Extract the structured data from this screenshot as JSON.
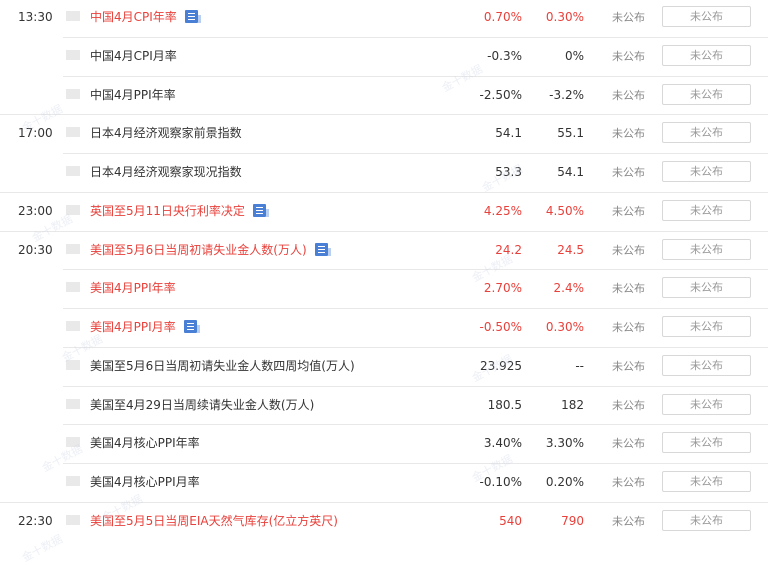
{
  "rows": [
    {
      "time": "13:30",
      "name": "中国4月CPI年率",
      "actual": "0.70%",
      "forecast": "0.30%",
      "status": "未公布",
      "button": "未公布",
      "red": true,
      "icon": true,
      "group_start": true
    },
    {
      "time": "",
      "name": "中国4月CPI月率",
      "actual": "-0.3%",
      "forecast": "0%",
      "status": "未公布",
      "button": "未公布",
      "red": false,
      "icon": false,
      "group_start": false
    },
    {
      "time": "",
      "name": "中国4月PPI年率",
      "actual": "-2.50%",
      "forecast": "-3.2%",
      "status": "未公布",
      "button": "未公布",
      "red": false,
      "icon": false,
      "group_start": false
    },
    {
      "time": "17:00",
      "name": "日本4月经济观察家前景指数",
      "actual": "54.1",
      "forecast": "55.1",
      "status": "未公布",
      "button": "未公布",
      "red": false,
      "icon": false,
      "group_start": true
    },
    {
      "time": "",
      "name": "日本4月经济观察家现况指数",
      "actual": "53.3",
      "forecast": "54.1",
      "status": "未公布",
      "button": "未公布",
      "red": false,
      "icon": false,
      "group_start": false
    },
    {
      "time": "23:00",
      "name": "英国至5月11日央行利率决定",
      "actual": "4.25%",
      "forecast": "4.50%",
      "status": "未公布",
      "button": "未公布",
      "red": true,
      "icon": true,
      "group_start": true
    },
    {
      "time": "20:30",
      "name": "美国至5月6日当周初请失业金人数(万人)",
      "actual": "24.2",
      "forecast": "24.5",
      "status": "未公布",
      "button": "未公布",
      "red": true,
      "icon": true,
      "group_start": true
    },
    {
      "time": "",
      "name": "美国4月PPI年率",
      "actual": "2.70%",
      "forecast": "2.4%",
      "status": "未公布",
      "button": "未公布",
      "red": true,
      "icon": false,
      "group_start": false
    },
    {
      "time": "",
      "name": "美国4月PPI月率",
      "actual": "-0.50%",
      "forecast": "0.30%",
      "status": "未公布",
      "button": "未公布",
      "red": true,
      "icon": true,
      "group_start": false
    },
    {
      "time": "",
      "name": "美国至5月6日当周初请失业金人数四周均值(万人)",
      "actual": "23.925",
      "forecast": "--",
      "status": "未公布",
      "button": "未公布",
      "red": false,
      "icon": false,
      "group_start": false
    },
    {
      "time": "",
      "name": "美国至4月29日当周续请失业金人数(万人)",
      "actual": "180.5",
      "forecast": "182",
      "status": "未公布",
      "button": "未公布",
      "red": false,
      "icon": false,
      "group_start": false
    },
    {
      "time": "",
      "name": "美国4月核心PPI年率",
      "actual": "3.40%",
      "forecast": "3.30%",
      "status": "未公布",
      "button": "未公布",
      "red": false,
      "icon": false,
      "group_start": false
    },
    {
      "time": "",
      "name": "美国4月核心PPI月率",
      "actual": "-0.10%",
      "forecast": "0.20%",
      "status": "未公布",
      "button": "未公布",
      "red": false,
      "icon": false,
      "group_start": false
    },
    {
      "time": "22:30",
      "name": "美国至5月5日当周EIA天然气库存(亿立方英尺)",
      "actual": "540",
      "forecast": "790",
      "status": "未公布",
      "button": "未公布",
      "red": true,
      "icon": false,
      "group_start": true
    }
  ],
  "colors": {
    "red": "#e8413b",
    "text": "#333333",
    "status": "#888888",
    "border": "#e8e8e8",
    "icon": "#4a7fd6"
  },
  "watermark": "金十数据"
}
